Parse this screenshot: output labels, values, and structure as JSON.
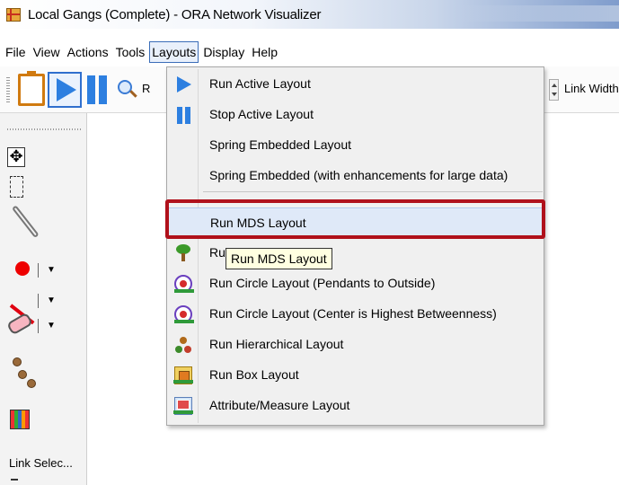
{
  "window": {
    "title": "Local Gangs (Complete) - ORA Network Visualizer"
  },
  "menubar": {
    "items": [
      "File",
      "View",
      "Actions",
      "Tools",
      "Layouts",
      "Display",
      "Help"
    ],
    "active": "Layouts"
  },
  "toolbar": {
    "partial_label": "R",
    "link_width_label": "Link Width"
  },
  "palette": {
    "tools": [
      "move-icon",
      "marquee-select-icon",
      "lasso-icon",
      "node-icon",
      "link-icon",
      "eraser-icon",
      "link-nodes-icon",
      "color-grid-icon"
    ],
    "link_selector_label": "Link Selec..."
  },
  "layouts_menu": {
    "items": [
      {
        "label": "Run Active Layout",
        "icon": "play-icon"
      },
      {
        "label": "Stop Active Layout",
        "icon": "pause-icon"
      },
      {
        "label": "Spring Embedded Layout",
        "icon": ""
      },
      {
        "label": "Spring Embedded (with enhancements for large data)",
        "icon": ""
      },
      {
        "label": "Run MDS Layout",
        "icon": "",
        "highlighted": true
      },
      {
        "label": "Ru",
        "icon": "tree-icon"
      },
      {
        "label": "Run Circle Layout (Pendants to Outside)",
        "icon": "circle-layout-icon"
      },
      {
        "label": "Run Circle Layout (Center is Highest Betweenness)",
        "icon": "circle-center-layout-icon"
      },
      {
        "label": "Run Hierarchical Layout",
        "icon": "hierarchical-layout-icon"
      },
      {
        "label": "Run Box Layout",
        "icon": "box-layout-icon"
      },
      {
        "label": "Attribute/Measure Layout",
        "icon": "attribute-layout-icon"
      }
    ]
  },
  "tooltip": {
    "text": "Run MDS Layout"
  },
  "colors": {
    "highlight_border": "#b0111b",
    "accent_blue": "#2d7fe0",
    "menu_background": "#f0f0f0",
    "tooltip_background": "#ffffe1"
  }
}
